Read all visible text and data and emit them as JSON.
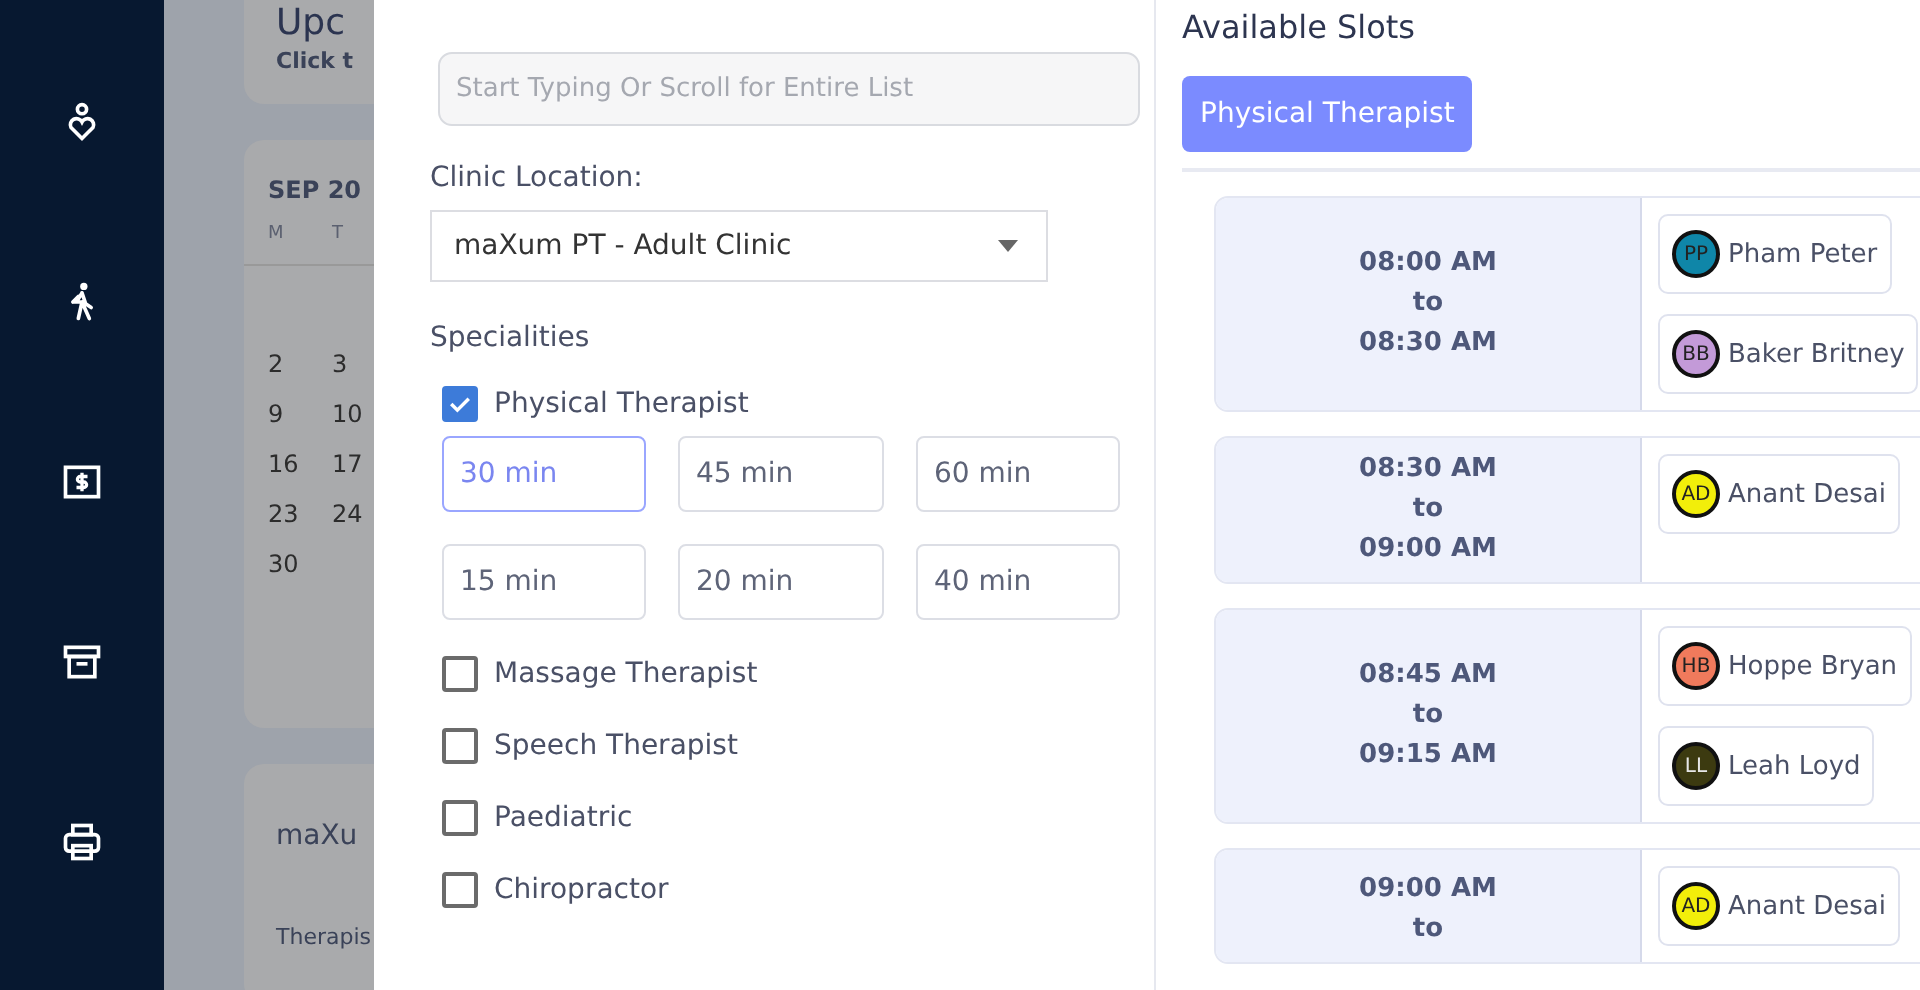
{
  "sidebar": {
    "icons": [
      {
        "kind": "heart-person"
      },
      {
        "kind": "walk"
      },
      {
        "kind": "money"
      },
      {
        "kind": "archive"
      },
      {
        "kind": "print"
      }
    ]
  },
  "background": {
    "upcoming_card": {
      "title": "Upc",
      "subtitle": "Click t"
    },
    "calendar": {
      "month": "SEP 20",
      "weekdays": [
        "M",
        "T"
      ],
      "weeks": [
        [
          "2",
          "3"
        ],
        [
          "9",
          "10"
        ],
        [
          "16",
          "17"
        ],
        [
          "23",
          "24"
        ],
        [
          "30"
        ]
      ]
    },
    "clinic_card": {
      "title": "maXu",
      "label": "Therapis"
    }
  },
  "form": {
    "therapist_search": {
      "placeholder": "Start Typing Or Scroll for Entire List"
    },
    "clinic_location": {
      "label": "Clinic Location:",
      "value": "maXum PT - Adult Clinic"
    },
    "specialities": {
      "label": "Specialities",
      "items": [
        {
          "label": "Physical Therapist",
          "checked": true,
          "durations": [
            {
              "label": "30 min",
              "selected": true
            },
            {
              "label": "45 min",
              "selected": false
            },
            {
              "label": "60 min",
              "selected": false
            },
            {
              "label": "15 min",
              "selected": false
            },
            {
              "label": "20 min",
              "selected": false
            },
            {
              "label": "40 min",
              "selected": false
            }
          ]
        },
        {
          "label": "Massage Therapist",
          "checked": false
        },
        {
          "label": "Speech Therapist",
          "checked": false
        },
        {
          "label": "Paediatric",
          "checked": false
        },
        {
          "label": "Chiropractor",
          "checked": false
        }
      ]
    }
  },
  "slots": {
    "title": "Available Slots",
    "tabs": [
      {
        "label": "Physical Therapist",
        "selected": true
      }
    ],
    "items": [
      {
        "start": "08:00 AM",
        "to": "to",
        "end": "08:30 AM",
        "therapists": [
          {
            "initials": "PP",
            "name": "Pham Peter",
            "color": "#0f86a8"
          },
          {
            "initials": "BB",
            "name": "Baker Britney",
            "color": "#c39ad8"
          }
        ]
      },
      {
        "start": "08:30 AM",
        "to": "to",
        "end": "09:00 AM",
        "therapists": [
          {
            "initials": "AD",
            "name": "Anant Desai",
            "color": "#f2ee0a"
          }
        ]
      },
      {
        "start": "08:45 AM",
        "to": "to",
        "end": "09:15 AM",
        "therapists": [
          {
            "initials": "HB",
            "name": "Hoppe Bryan",
            "color": "#f07a5c"
          },
          {
            "initials": "LL",
            "name": "Leah Loyd",
            "color": "#3c3a10"
          }
        ]
      },
      {
        "start": "09:00 AM",
        "to": "to",
        "therapists": [
          {
            "initials": "AD",
            "name": "Anant Desai",
            "color": "#f2ee0a"
          }
        ]
      }
    ]
  }
}
